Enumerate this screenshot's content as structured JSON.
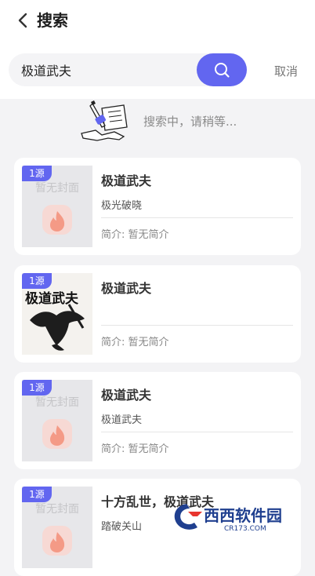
{
  "header": {
    "title": "搜索"
  },
  "search": {
    "query": "极道武夫",
    "cancel_label": "取消"
  },
  "status": {
    "text": "搜索中，请稍等..."
  },
  "results": [
    {
      "badge": "1源",
      "title": "极道武夫",
      "author": "极光破晓",
      "intro": "简介: 暂无简介",
      "cover_text": "暂无封面",
      "cover_type": "placeholder"
    },
    {
      "badge": "1源",
      "title": "极道武夫",
      "author": "",
      "intro": "简介: 暂无简介",
      "cover_text": "极道武夫",
      "cover_type": "artwork"
    },
    {
      "badge": "1源",
      "title": "极道武夫",
      "author": "极道武夫",
      "intro": "简介: 暂无简介",
      "cover_text": "暂无封面",
      "cover_type": "placeholder"
    },
    {
      "badge": "1源",
      "title": "十方乱世，极道武夫",
      "author": "踏破关山",
      "intro": "",
      "cover_text": "暂无封面",
      "cover_type": "placeholder"
    }
  ],
  "watermark": {
    "text": "西西软件园",
    "subtext": "CR173.COM"
  },
  "colors": {
    "accent": "#6266f0",
    "background": "#f3f3f5",
    "card": "#ffffff"
  }
}
